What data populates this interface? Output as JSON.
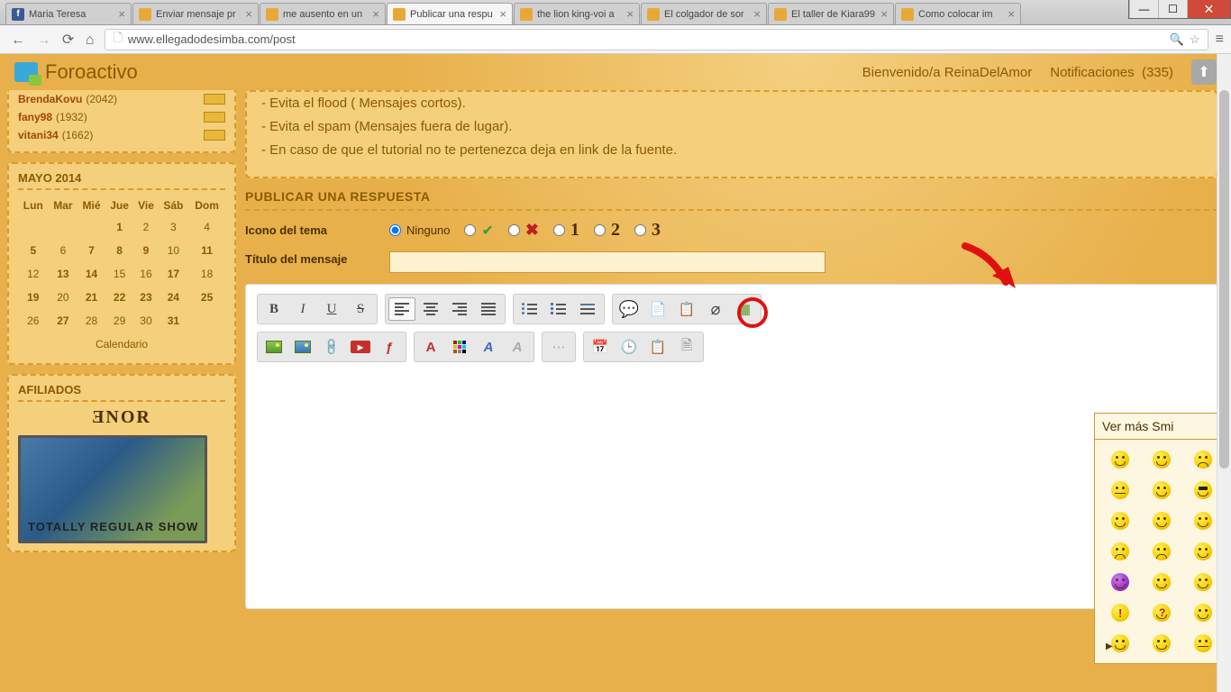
{
  "window": {
    "min": "—",
    "max": "☐",
    "close": "✕"
  },
  "browser": {
    "tabs": [
      {
        "title": "Maria Teresa",
        "favicon": "fb"
      },
      {
        "title": "Enviar mensaje pr",
        "favicon": "f"
      },
      {
        "title": "me ausento en un",
        "favicon": "f"
      },
      {
        "title": "Publicar una respu",
        "favicon": "f",
        "active": true
      },
      {
        "title": "the lion king-voi a",
        "favicon": "f"
      },
      {
        "title": "El colgador de sor",
        "favicon": "f"
      },
      {
        "title": "El taller de Kiara99",
        "favicon": "f"
      },
      {
        "title": "Como colocar im",
        "favicon": "f"
      }
    ],
    "nav": {
      "back": "←",
      "fwd": "→",
      "reload": "⟳",
      "home": "⌂"
    },
    "url": "www.ellegadodesimba.com/post",
    "menu": "≡"
  },
  "header": {
    "brand": "Foroactivo",
    "welcome": "Bienvenido/a ReinaDelAmor",
    "notif_label": "Notificaciones",
    "notif_count": "(335)"
  },
  "members": [
    {
      "name": "BrendaKovu",
      "count": "(2042)"
    },
    {
      "name": "fany98",
      "count": "(1932)"
    },
    {
      "name": "vitani34",
      "count": "(1662)"
    }
  ],
  "calendar": {
    "title": "MAYO 2014",
    "dow": [
      "Lun",
      "Mar",
      "Mié",
      "Jue",
      "Vie",
      "Sáb",
      "Dom"
    ],
    "rows": [
      [
        "",
        "",
        "",
        "1",
        "2",
        "3",
        "4"
      ],
      [
        "5",
        "6",
        "7",
        "8",
        "9",
        "10",
        "11"
      ],
      [
        "12",
        "13",
        "14",
        "15",
        "16",
        "17",
        "18"
      ],
      [
        "19",
        "20",
        "21",
        "22",
        "23",
        "24",
        "25"
      ],
      [
        "26",
        "27",
        "28",
        "29",
        "30",
        "31",
        ""
      ]
    ],
    "bold_cells": [
      "1",
      "5",
      "7",
      "8",
      "9",
      "11",
      "13",
      "14",
      "17",
      "19",
      "21",
      "22",
      "23",
      "24",
      "25",
      "27",
      "31"
    ],
    "footer": "Calendario"
  },
  "affiliates": {
    "title": "AFILIADOS",
    "banner_text": "TOTALLY REGULAR SHOW",
    "decor": "ƎNOR"
  },
  "rules": {
    "r1": "- Evita el flood ( Mensajes cortos).",
    "r2": "- Evita el spam (Mensajes fuera de lugar).",
    "r3": "- En caso de que el tutorial no te pertenezca deja en link de la fuente."
  },
  "reply": {
    "heading": "PUBLICAR UNA RESPUESTA",
    "icon_label": "Icono del tema",
    "none": "Ninguno",
    "opts": {
      "n1": "1",
      "n2": "2",
      "n3": "3"
    },
    "title_label": "Título del mensaje",
    "title_value": ""
  },
  "toolbar": {
    "bold": "B",
    "italic": "I",
    "underline": "U",
    "strike": "S",
    "yt": "You Tube",
    "fontfam": "A",
    "fontcolor": "A",
    "fontsize": "A",
    "fontrm": "A"
  },
  "smileys": {
    "header": "Ver más Smi"
  }
}
